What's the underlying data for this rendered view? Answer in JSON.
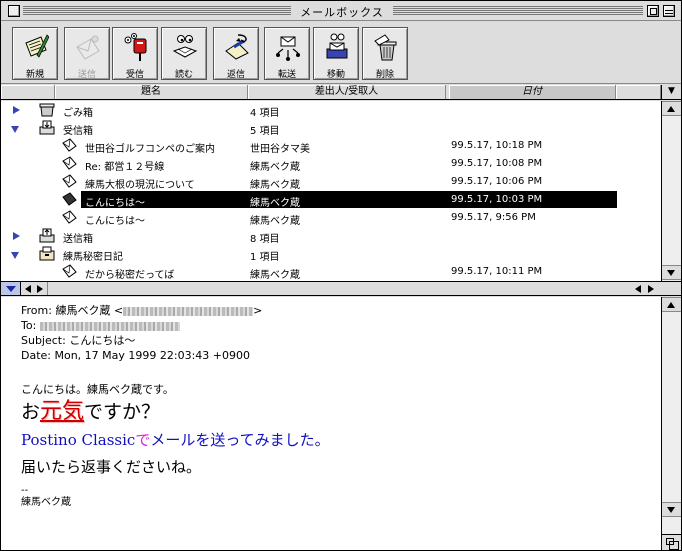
{
  "window": {
    "title": "メールボックス"
  },
  "toolbar": {
    "buttons": [
      {
        "label": "新規",
        "icon": "new-message-icon",
        "enabled": true
      },
      {
        "label": "送信",
        "icon": "send-icon",
        "enabled": false
      },
      {
        "label": "受信",
        "icon": "receive-mailbox-icon",
        "enabled": true
      },
      {
        "label": "読む",
        "icon": "read-icon",
        "enabled": true
      },
      {
        "label": "返信",
        "icon": "reply-icon",
        "enabled": true
      },
      {
        "label": "転送",
        "icon": "forward-icon",
        "enabled": true
      },
      {
        "label": "移動",
        "icon": "move-icon",
        "enabled": true
      },
      {
        "label": "削除",
        "icon": "trash-icon",
        "enabled": true
      }
    ]
  },
  "columns": {
    "subject": "題名",
    "from": "差出人/受取人",
    "date": "日付",
    "sort_icon": "sort-toggle-icon"
  },
  "mailboxes": [
    {
      "type": "folder",
      "expanded": false,
      "icon": "trash-folder-icon",
      "name": "ごみ箱",
      "count": "4 項目"
    },
    {
      "type": "folder",
      "expanded": true,
      "icon": "inbox-folder-icon",
      "name": "受信箱",
      "count": "5 項目"
    },
    {
      "type": "message",
      "subject": "世田谷ゴルフコンペのご案内",
      "from": "世田谷タマ美",
      "date": "99.5.17, 10:18 PM"
    },
    {
      "type": "message",
      "subject": "Re: 都営１２号線",
      "from": "練馬ベク蔵",
      "date": "99.5.17, 10:08 PM"
    },
    {
      "type": "message",
      "subject": "練馬大根の現況について",
      "from": "練馬ベク蔵",
      "date": "99.5.17, 10:06 PM"
    },
    {
      "type": "message",
      "subject": "こんにちは〜",
      "from": "練馬ベク蔵",
      "date": "99.5.17, 10:03 PM",
      "selected": true
    },
    {
      "type": "message",
      "subject": "こんにちは〜",
      "from": "練馬ベク蔵",
      "date": "99.5.17, 9:56 PM"
    },
    {
      "type": "folder",
      "expanded": false,
      "icon": "outbox-folder-icon",
      "name": "送信箱",
      "count": "8 項目"
    },
    {
      "type": "folder",
      "expanded": true,
      "icon": "custom-folder-icon",
      "name": "練馬秘密日記",
      "count": "1 項目"
    },
    {
      "type": "message",
      "subject": "だから秘密だってば",
      "from": "練馬ベク蔵",
      "date": "99.5.17, 10:11 PM"
    }
  ],
  "message": {
    "from_label": "From: 練馬ベク蔵 <",
    "from_end": ">",
    "to_label": "To: ",
    "subject_line": "Subject: こんにちは〜",
    "date_line": "Date: Mon, 17 May 1999 22:03:43 +0900",
    "body": {
      "line1": "こんにちは。練馬ベク蔵です。",
      "line2_a": "お",
      "line2_b": "元気",
      "line2_c": "ですか？",
      "line3_a": "Postino Classic",
      "line3_b": "で",
      "line3_c": "メールを送ってみました。",
      "line4": "届いたら返事くださいね。",
      "sig_dash": "--",
      "sig_name": "練馬ベク蔵"
    },
    "colors": {
      "genki": "#cc0000",
      "blue_text": "#1010c0",
      "magenta": "#e020e0"
    }
  }
}
